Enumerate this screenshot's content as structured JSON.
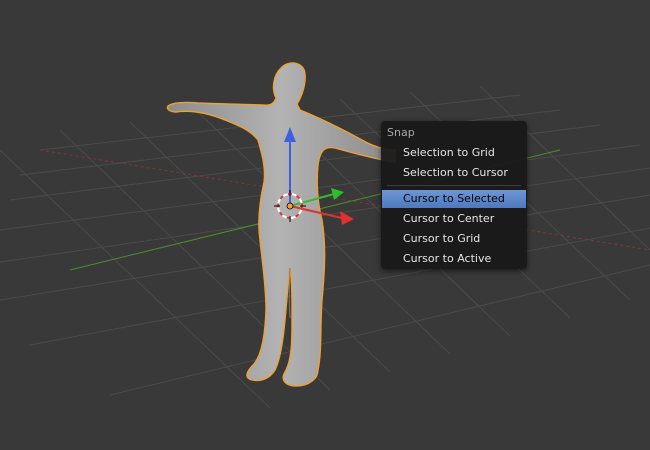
{
  "viewport": {
    "background": "#393939",
    "grid_color": "#4a4a4a",
    "x_axis_color": "#a83a3a",
    "y_axis_color": "#5a9a2a",
    "selection_outline": "#f0a030",
    "model_color": "#9d9d9d"
  },
  "snap_menu": {
    "title": "Snap",
    "items": [
      {
        "label": "Selection to Grid",
        "active": false
      },
      {
        "label": "Selection to Cursor",
        "active": false
      },
      {
        "label": "Cursor to Selected",
        "active": true
      },
      {
        "label": "Cursor to Center",
        "active": false
      },
      {
        "label": "Cursor to Grid",
        "active": false
      },
      {
        "label": "Cursor to Active",
        "active": false
      }
    ]
  },
  "gizmo": {
    "z_arrow": "blue",
    "x_arrow": "red",
    "y_arrow": "green"
  }
}
